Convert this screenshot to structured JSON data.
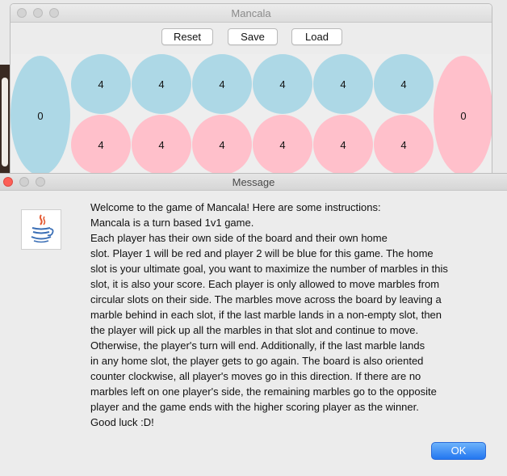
{
  "main_window": {
    "title": "Mancala",
    "buttons": {
      "reset": "Reset",
      "save": "Save",
      "load": "Load"
    },
    "board": {
      "left_store": "0",
      "right_store": "0",
      "top_row": [
        "4",
        "4",
        "4",
        "4",
        "4",
        "4"
      ],
      "bottom_row": [
        "4",
        "4",
        "4",
        "4",
        "4",
        "4"
      ],
      "colors": {
        "player2_blue": "#add8e6",
        "player1_red": "#ffc0cb"
      }
    }
  },
  "dialog": {
    "title": "Message",
    "icon": "java-coffee-cup-icon",
    "lines": [
      "Welcome to the game of Mancala! Here are some instructions:",
      "Mancala is a turn based 1v1 game.",
      "Each player has their own side of the board and their own home",
      "slot. Player 1 will be red and player 2 will be blue for this game. The home",
      "slot is your ultimate goal, you want to maximize the number of marbles in this",
      "slot, it is also your score. Each player is only allowed to move marbles from",
      "circular slots on their side. The marbles move across the board by leaving a",
      "marble behind in each slot, if the last marble lands in a non-empty slot, then",
      "the player will pick up all the marbles in that slot and continue to move.",
      "Otherwise, the player's turn will end. Additionally, if the last marble lands",
      "in any home slot, the player gets to go again. The board is also oriented",
      "counter clockwise, all player's moves go in this direction. If there are no",
      "marbles left on one player's side, the remaining marbles go to the opposite",
      "player and the game ends with the higher scoring player as the winner.",
      "Good luck :D!"
    ],
    "ok_label": "OK",
    "accent": "#2376f0"
  }
}
